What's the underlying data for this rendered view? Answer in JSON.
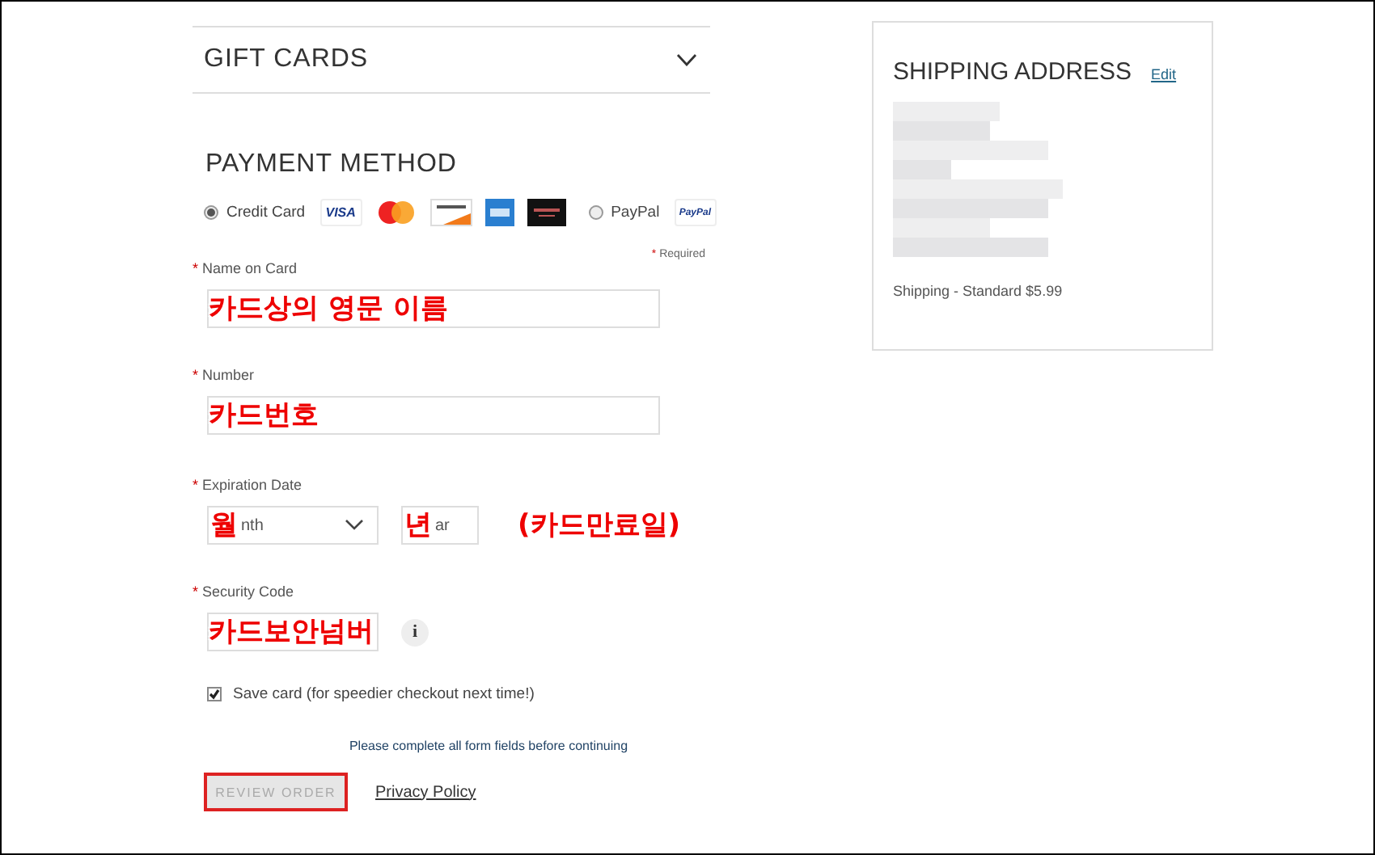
{
  "gift_cards": {
    "title": "GIFT CARDS",
    "expanded": false
  },
  "payment": {
    "title": "PAYMENT METHOD",
    "methods": [
      {
        "label": "Credit Card",
        "selected": true,
        "logos": [
          {
            "kind": "visa",
            "text": "VISA"
          },
          {
            "kind": "mastercard"
          },
          {
            "kind": "discover"
          },
          {
            "kind": "amex"
          },
          {
            "kind": "darkcard"
          }
        ]
      },
      {
        "label": "PayPal",
        "selected": false,
        "logos": [
          {
            "kind": "paypal",
            "text": "PayPal"
          }
        ]
      }
    ],
    "required_mark": "*",
    "required_note": "Required",
    "fields": [
      {
        "kind": "text",
        "label": "Name on Card",
        "annotation": "카드상의 영문 이름"
      },
      {
        "kind": "text",
        "label": "Number",
        "annotation": "카드번호"
      },
      {
        "kind": "expiry",
        "label": "Expiration Date",
        "month": {
          "value": "nth",
          "annotation": "월"
        },
        "year": {
          "value": "ar",
          "annotation": "년"
        },
        "annotation": "(카드만료일)"
      },
      {
        "kind": "security",
        "label": "Security Code",
        "annotation": "카드보안넘버",
        "info": "i"
      }
    ],
    "save_card": {
      "label": "Save card (for speedier checkout next time!)",
      "checked": true
    },
    "message": "Please complete all form fields before continuing",
    "review_button": {
      "label": "REVIEW ORDER",
      "disabled": true
    },
    "privacy_link": "Privacy Policy"
  },
  "shipping": {
    "title": "SHIPPING ADDRESS",
    "edit": "Edit",
    "method": "Shipping - Standard $5.99"
  }
}
